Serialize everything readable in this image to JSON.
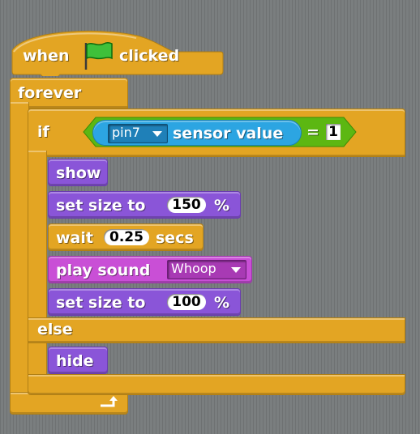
{
  "script": {
    "hat": {
      "before_flag": "when",
      "flag_icon": "green-flag-icon",
      "after_flag": "clicked"
    },
    "forever": {
      "label": "forever",
      "loop_icon": "loop-arrow-icon"
    },
    "if_else": {
      "if_label": "if",
      "else_label": "else"
    },
    "condition": {
      "sensor_dropdown": "pin7",
      "sensor_label": "sensor value",
      "operator": "=",
      "compare_value": "1"
    },
    "then_blocks": {
      "show": "show",
      "set_size_1": {
        "label": "set size to",
        "value": "150",
        "unit": "%"
      },
      "wait": {
        "label": "wait",
        "value": "0.25",
        "unit": "secs"
      },
      "play_sound": {
        "label": "play sound",
        "sound": "Whoop"
      },
      "set_size_2": {
        "label": "set size to",
        "value": "100",
        "unit": "%"
      }
    },
    "else_blocks": {
      "hide": "hide"
    }
  },
  "colors": {
    "control": "#e3a523",
    "looks": "#8a55d8",
    "sound": "#c94fd6",
    "sensing": "#2ca5e2",
    "operators": "#5cb712",
    "background": "#7a7e7f"
  }
}
